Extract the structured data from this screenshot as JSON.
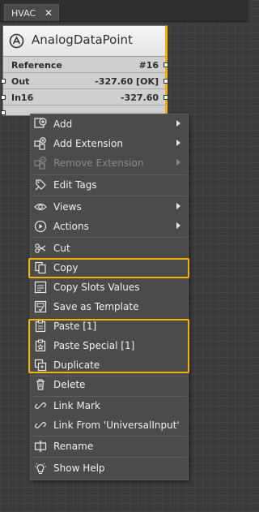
{
  "tab": {
    "label": "HVAC",
    "close": "✕"
  },
  "block": {
    "title": "AnalogDataPoint",
    "slots": [
      {
        "name": "Reference",
        "value": "#16"
      },
      {
        "name": "Out",
        "value": "-327.60 [OK]"
      },
      {
        "name": "In16",
        "value": "-327.60"
      }
    ]
  },
  "menu": {
    "items": [
      {
        "label": "Add",
        "icon": "add-icon",
        "submenu": true
      },
      {
        "label": "Add Extension",
        "icon": "add-extension-icon",
        "submenu": true
      },
      {
        "label": "Remove Extension",
        "icon": "remove-extension-icon",
        "submenu": true,
        "disabled": true
      },
      {
        "label": "Edit Tags",
        "icon": "edit-tags-icon"
      },
      {
        "label": "Views",
        "icon": "eye-icon",
        "submenu": true
      },
      {
        "label": "Actions",
        "icon": "play-icon",
        "submenu": true
      },
      {
        "label": "Cut",
        "icon": "scissors-icon"
      },
      {
        "label": "Copy",
        "icon": "copy-icon"
      },
      {
        "label": "Copy Slots Values",
        "icon": "copy-slots-icon"
      },
      {
        "label": "Save as Template",
        "icon": "save-template-icon"
      },
      {
        "label": "Paste [1]",
        "icon": "paste-icon"
      },
      {
        "label": "Paste Special [1]",
        "icon": "paste-special-icon"
      },
      {
        "label": "Duplicate",
        "icon": "duplicate-icon"
      },
      {
        "label": "Delete",
        "icon": "trash-icon"
      },
      {
        "label": "Link Mark",
        "icon": "link-icon"
      },
      {
        "label": "Link From 'UniversalInput'",
        "icon": "link-from-icon"
      },
      {
        "label": "Rename",
        "icon": "rename-icon"
      },
      {
        "label": "Show Help",
        "icon": "lightbulb-icon"
      }
    ]
  },
  "colors": {
    "highlight": "#f4b300",
    "menu_bg": "#4b4b4b",
    "canvas_bg": "#3a3a3a"
  }
}
